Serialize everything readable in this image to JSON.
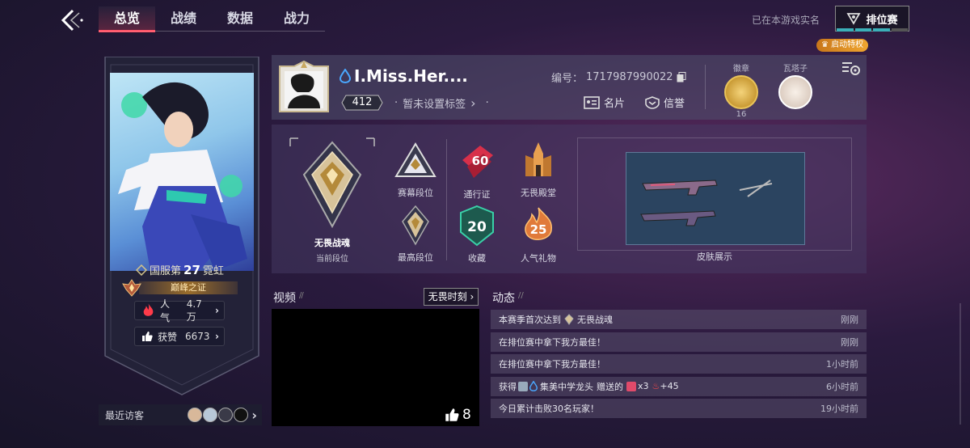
{
  "nav": {
    "tabs": [
      "总览",
      "战绩",
      "数据",
      "战力"
    ],
    "active_tab": 0,
    "realname_status": "已在本游戏实名",
    "rank_button": "排位赛",
    "privilege": "启动特权"
  },
  "hero_banner": {
    "server_rank_prefix": "国服第",
    "server_rank_number": "27",
    "server_rank_hero": "霓虹",
    "peak_proof": "巅峰之证",
    "popularity_label": "人气",
    "popularity_value": "4.7万",
    "likes_label": "获赞",
    "likes_value": "6673"
  },
  "visitors": {
    "label": "最近访客"
  },
  "profile": {
    "name": "I.Miss.Her....",
    "level": "412",
    "tag": "暂未设置标签",
    "uid_label": "编号：",
    "uid": "1717987990022",
    "namecard": "名片",
    "credit": "信誉",
    "badge_label": "徽章",
    "badge_count": "16",
    "tower_label": "瓦塔子"
  },
  "achievements": {
    "current_rank_name": "无畏战魂",
    "current_rank_label": "当前段位",
    "season_rank": "赛幕段位",
    "highest_rank": "最高段位",
    "pass_label": "通行证",
    "pass_level": "60",
    "collection_label": "收藏",
    "collection_count": "20",
    "hall_label": "无畏殿堂",
    "gift_label": "人气礼物",
    "gift_count": "25",
    "skin_label": "皮肤展示"
  },
  "video": {
    "title": "视频",
    "more": "无畏时刻",
    "likes": "8"
  },
  "activity": {
    "title": "动态",
    "rows": [
      {
        "text": "本赛季首次达到",
        "extra": "无畏战魂",
        "time": "刚刚"
      },
      {
        "text": "在排位赛中拿下我方最佳！",
        "extra": "",
        "time": "刚刚"
      },
      {
        "text": "在排位赛中拿下我方最佳！",
        "extra": "",
        "time": "1小时前"
      },
      {
        "text": "获得",
        "extra": "集美中学龙头",
        "extra2": "赠送的",
        "count": "x3",
        "plus": "+45",
        "time": "6小时前"
      },
      {
        "text": "今日累计击败30名玩家！",
        "extra": "",
        "time": "19小时前"
      }
    ]
  },
  "colors": {
    "accent_red": "#ff4a5e",
    "gold": "#d4a64a",
    "teal": "#3bb0b8"
  }
}
